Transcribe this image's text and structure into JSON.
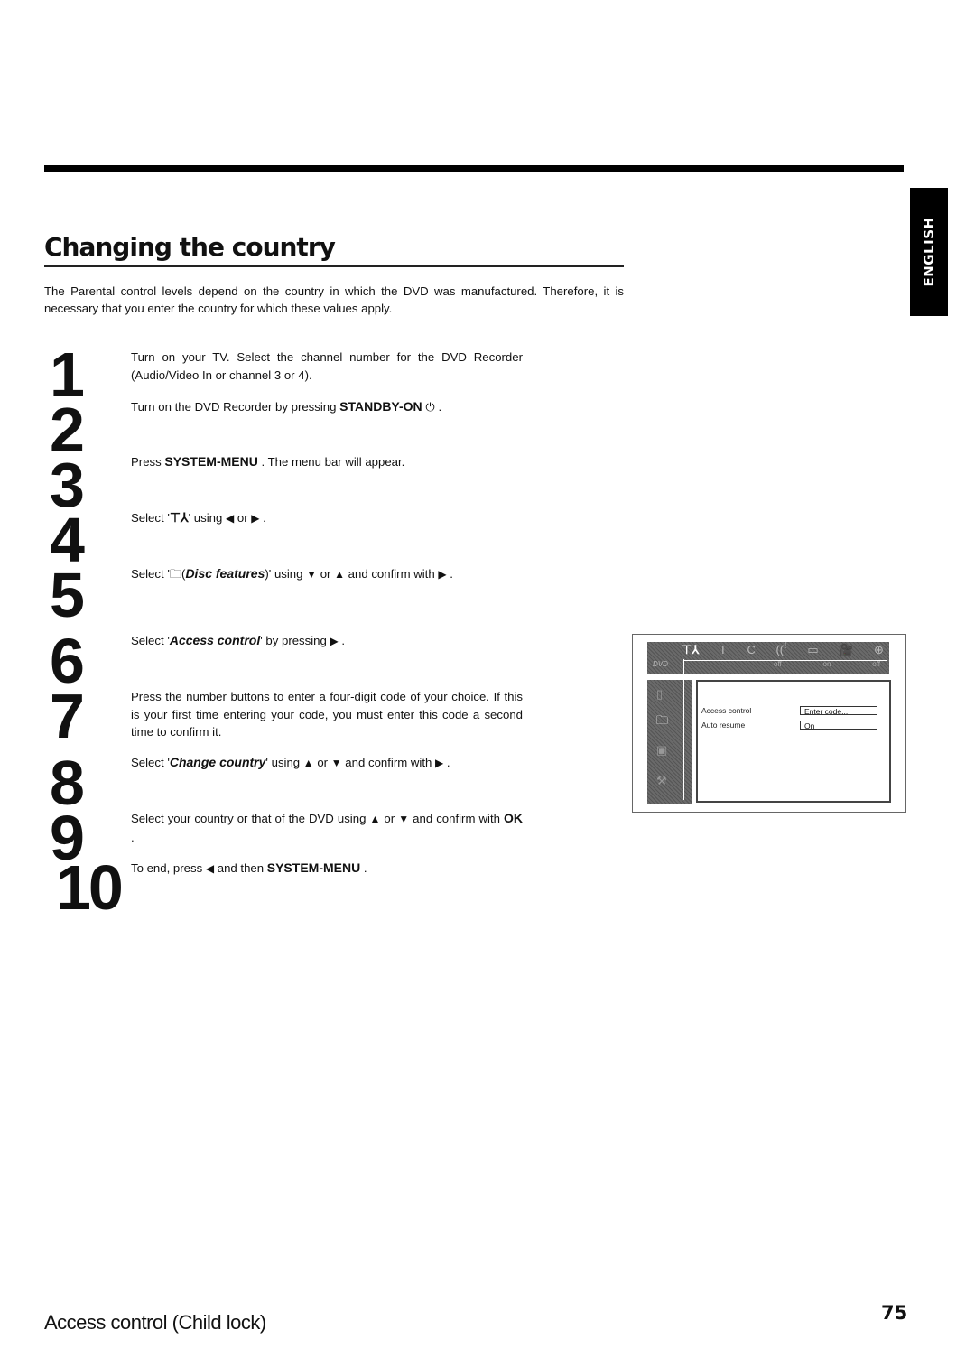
{
  "language_tab": "ENGLISH",
  "title": "Changing the country",
  "intro": "The Parental control levels depend on the country in which the DVD was manufactured. Therefore, it is necessary that you enter the country for which these values apply.",
  "steps": [
    {
      "number": "1",
      "text": "Turn on your TV. Select the channel number for the DVD Recorder (Audio/Video In or channel 3 or 4)."
    },
    {
      "number": "2",
      "pre": "Turn on the DVD Recorder by pressing ",
      "key": "STANDBY-ON",
      "icon": "power-icon",
      "post": " ."
    },
    {
      "number": "3",
      "pre": "Press ",
      "key": "SYSTEM-MENU",
      "post": " . The menu bar will appear."
    },
    {
      "number": "4",
      "pre": "Select '",
      "icon": "settings-tools-icon",
      "mid": "' using ",
      "a1": "left-arrow",
      "or": " or ",
      "a2": "right-arrow",
      "post": " ."
    },
    {
      "number": "5",
      "pre": "Select '",
      "icon": "disc-features-icon",
      "em": "Disc features",
      "mid": ")' using ",
      "a1": "down-arrow",
      "or": " or ",
      "a2": "up-arrow",
      "post": " and confirm with ",
      "a3": "right-arrow",
      "end": " ."
    },
    {
      "number": "6",
      "pre": "Select '",
      "em": "Access control",
      "post": "' by pressing ",
      "a1": "right-arrow",
      "end": " ."
    },
    {
      "number": "7",
      "text": "Press the number buttons to enter a four-digit code of your choice. If this is your first time entering your code, you must enter this code a second time to confirm it."
    },
    {
      "number": "8",
      "pre": "Select '",
      "em": "Change country",
      "post": "' using ",
      "a1": "up-arrow",
      "or": " or ",
      "a2": "down-arrow",
      "mid": " and confirm with ",
      "a3": "right-arrow",
      "end": " ."
    },
    {
      "number": "9",
      "pre": "Select your country or that of the DVD using ",
      "a1": "up-arrow",
      "or": " or ",
      "a2": "down-arrow",
      "mid": " and confirm with ",
      "key": "OK",
      "end": " ."
    },
    {
      "number": "10",
      "pre": "To end, press ",
      "a1": "left-arrow",
      "mid": " and then ",
      "key": "SYSTEM-MENU",
      "end": " ."
    }
  ],
  "osd": {
    "logo": "DVD",
    "bar_values": [
      "off",
      "on",
      "off"
    ],
    "rows": [
      {
        "label": "Access control",
        "value": "Enter code..."
      },
      {
        "label": "Auto resume",
        "value": "On"
      }
    ]
  },
  "footer": {
    "section": "Access control (Child lock)",
    "page_number": "75"
  }
}
